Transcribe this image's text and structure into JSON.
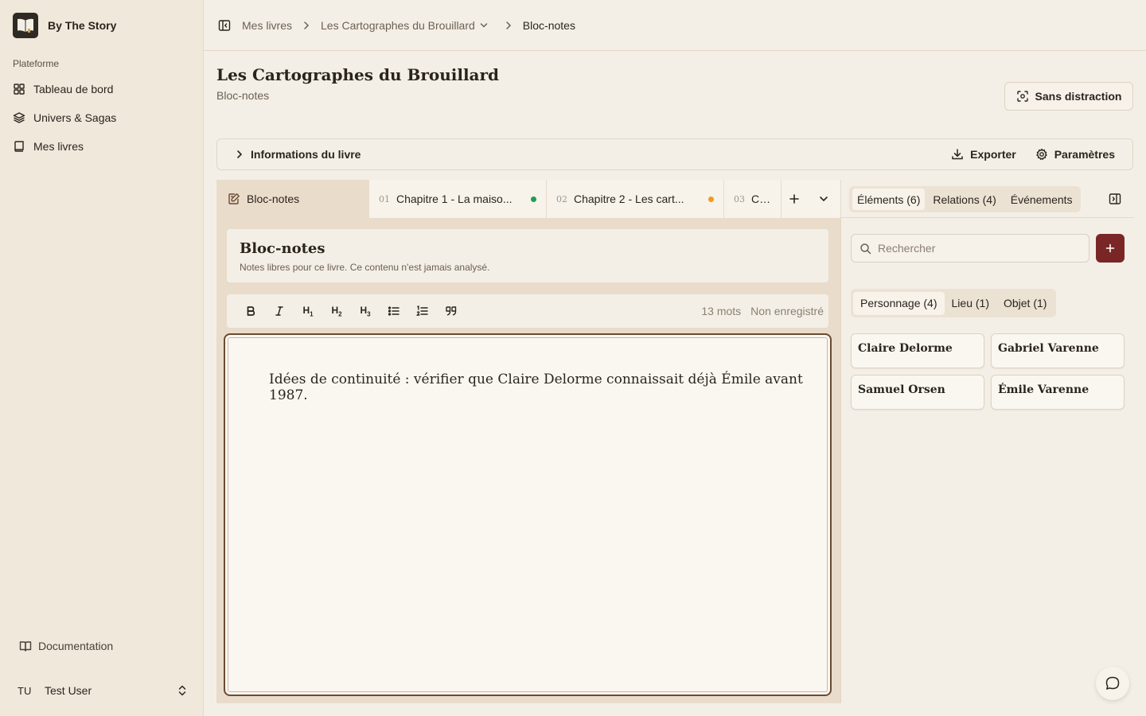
{
  "brand": {
    "name": "By The Story"
  },
  "sidebar": {
    "section": "Plateforme",
    "items": [
      {
        "label": "Tableau de bord",
        "icon": "dashboard-icon"
      },
      {
        "label": "Univers & Sagas",
        "icon": "layers-icon"
      },
      {
        "label": "Mes livres",
        "icon": "book-icon"
      }
    ],
    "documentation": "Documentation",
    "user": {
      "initials": "TU",
      "name": "Test User"
    }
  },
  "breadcrumb": {
    "items": [
      "Mes livres",
      "Les Cartographes du Brouillard",
      "Bloc-notes"
    ]
  },
  "header": {
    "title": "Les Cartographes du Brouillard",
    "subtitle": "Bloc-notes",
    "focus_label": "Sans distraction"
  },
  "info_bar": {
    "label": "Informations du livre",
    "export_label": "Exporter",
    "settings_label": "Paramètres"
  },
  "tabs": [
    {
      "num": "",
      "label": "Bloc-notes",
      "status": "",
      "active": true
    },
    {
      "num": "01",
      "label": "Chapitre 1 - La maiso...",
      "status": "#1f9d55"
    },
    {
      "num": "02",
      "label": "Chapitre 2 - Les cart...",
      "status": "#f29a1e"
    },
    {
      "num": "03",
      "label": "Chap",
      "status": ""
    }
  ],
  "note": {
    "title": "Bloc-notes",
    "description": "Notes libres pour ce livre. Ce contenu n'est jamais analysé.",
    "word_count": "13 mots",
    "save_status": "Non enregistré",
    "content": "Idées de continuité : vérifier que Claire Delorme connaissait déjà Émile avant 1987."
  },
  "toolbar": {
    "h1": "H",
    "h2": "H",
    "h3": "H",
    "h1_sub": "1",
    "h2_sub": "2",
    "h3_sub": "3"
  },
  "right_panel": {
    "tabs": [
      "Éléments (6)",
      "Relations (4)",
      "Événements"
    ],
    "search_placeholder": "Rechercher",
    "filters": [
      "Personnage (4)",
      "Lieu (1)",
      "Objet (1)"
    ],
    "cards": [
      "Claire Delorme",
      "Gabriel Varenne",
      "Samuel Orsen",
      "Émile Varenne"
    ]
  },
  "colors": {
    "accent": "#7a2626",
    "status_green": "#1f9d55",
    "status_orange": "#f29a1e"
  }
}
